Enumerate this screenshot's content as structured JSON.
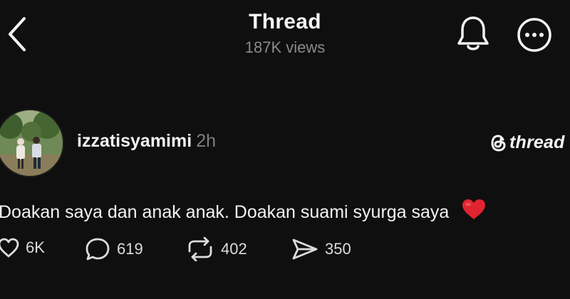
{
  "header": {
    "title": "Thread",
    "views": "187K views"
  },
  "post": {
    "username": "izzatisyamimi",
    "time": "2h",
    "brand": "thread",
    "text": "Doakan saya dan anak anak. Doakan suami syurga saya"
  },
  "actions": {
    "likes": "6K",
    "replies": "619",
    "reposts": "402",
    "shares": "350"
  },
  "colors": {
    "background": "#0f0f0f",
    "text": "#f3f3f3",
    "muted": "#8a8a8a",
    "heart": "#e0242f"
  },
  "icons": [
    "back-chevron-icon",
    "bell-icon",
    "more-options-icon",
    "threads-logo-icon",
    "heart-emoji-icon",
    "like-icon",
    "reply-icon",
    "repost-icon",
    "share-icon"
  ]
}
